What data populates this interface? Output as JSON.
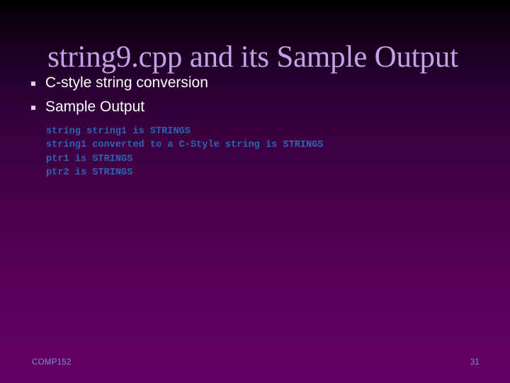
{
  "slide": {
    "title": "string9.cpp and its Sample Output",
    "bullets": [
      {
        "label": "C-style string conversion"
      },
      {
        "label": "Sample Output"
      }
    ],
    "sample_output_lines": [
      "string string1 is STRINGS",
      "string1 converted to a C-Style string is STRINGS",
      "ptr1 is STRINGS",
      "ptr2 is STRINGS"
    ],
    "footer": {
      "course": "COMP152",
      "page_number": "31"
    }
  },
  "colors": {
    "title": "#c8a0e6",
    "bullet_text": "#ffffff",
    "bullet_marker": "#e8cce8",
    "code_text": "#2f63b4",
    "footer_text": "#7e8ede",
    "background_top": "#000000",
    "background_bottom": "#640064"
  },
  "icons": {
    "bullet": "square-bullet-icon"
  }
}
